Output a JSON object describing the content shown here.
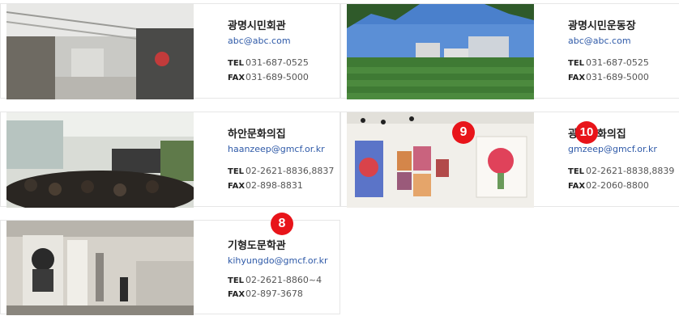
{
  "venues": [
    {
      "name": "광명시민회관",
      "email": "abc@abc.com",
      "tel_label": "TEL",
      "tel": "031-687-0525",
      "fax_label": "FAX",
      "fax": "031-689-5000"
    },
    {
      "name": "광명시민운동장",
      "email": "abc@abc.com",
      "tel_label": "TEL",
      "tel": "031-687-0525",
      "fax_label": "FAX",
      "fax": "031-689-5000"
    },
    {
      "name": "하안문화의집",
      "email": "haanzeep@gmcf.or.kr",
      "tel_label": "TEL",
      "tel": "02-2621-8836,8837",
      "fax_label": "FAX",
      "fax": "02-898-8831"
    },
    {
      "name": "광명문화의집",
      "email": "gmzeep@gmcf.or.kr",
      "tel_label": "TEL",
      "tel": "02-2621-8838,8839",
      "fax_label": "FAX",
      "fax": "02-2060-8800"
    },
    {
      "name": "기형도문학관",
      "email": "kihyungdo@gmcf.or.kr",
      "tel_label": "TEL",
      "tel": "02-2621-8860~4",
      "fax_label": "FAX",
      "fax": "02-897-3678"
    }
  ],
  "badges": {
    "b8": "8",
    "b9": "9",
    "b10": "10"
  },
  "colors": {
    "badge": "#e8141a",
    "email": "#2f5aa8"
  }
}
